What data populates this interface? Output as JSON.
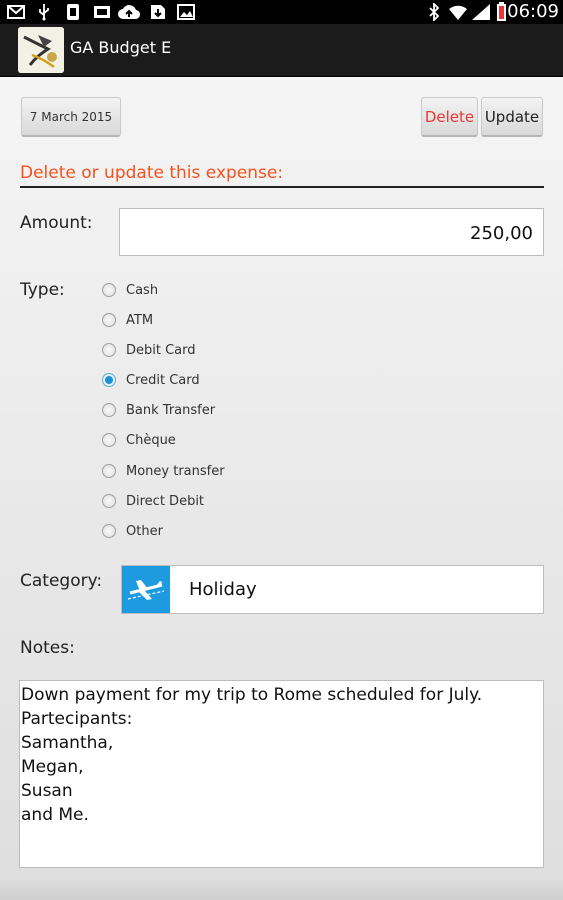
{
  "status_bar": {
    "time": "06:09",
    "icons": [
      "mail-icon",
      "usb-icon",
      "notification-icon",
      "photo-icon",
      "cloud-upload-icon",
      "download-icon",
      "image-icon",
      "bluetooth-icon",
      "wifi-icon",
      "signal-icon",
      "battery-icon"
    ]
  },
  "app": {
    "title": "GA Budget E"
  },
  "toolbar": {
    "date_label": "7 March 2015",
    "delete_label": "Delete",
    "update_label": "Update"
  },
  "form": {
    "section_title": "Delete or update this expense:",
    "amount_label": "Amount:",
    "amount_value": "250,00",
    "type_label": "Type:",
    "types": [
      "Cash",
      "ATM",
      "Debit Card",
      "Credit Card",
      "Bank Transfer",
      "Chèque",
      "Money transfer",
      "Direct Debit",
      "Other"
    ],
    "selected_type": "Credit Card",
    "category_label": "Category:",
    "category_value": "Holiday",
    "category_icon": "airplane-icon",
    "notes_label": "Notes:",
    "notes_lines": [
      "Down payment for my trip to Rome scheduled for July.",
      "Partecipants:",
      "Samantha,",
      "Megan,",
      "Susan",
      "and Me."
    ]
  },
  "colors": {
    "accent_orange": "#f4511e",
    "delete_red": "#e53935",
    "category_blue": "#1e9be0",
    "radio_blue": "#1e90d6"
  }
}
